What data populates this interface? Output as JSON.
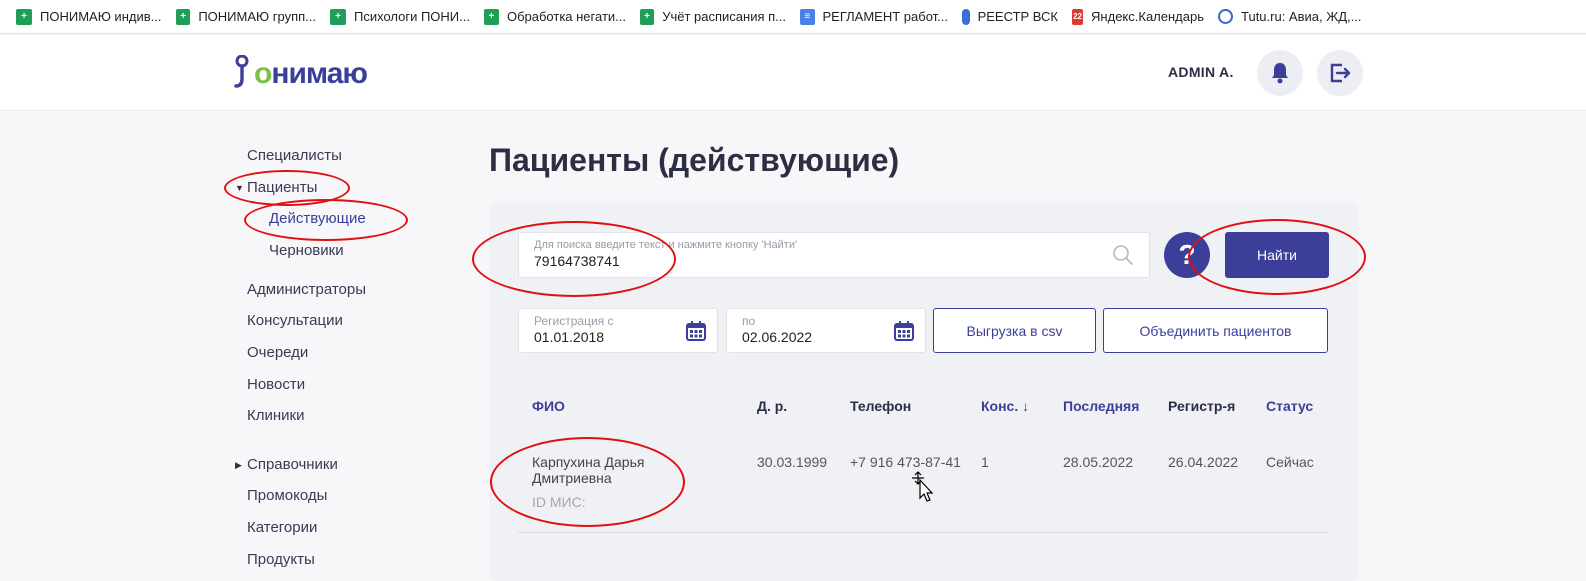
{
  "bookmarks": [
    {
      "label": "ПОНИМАЮ индив...",
      "icon": "sheet-icon"
    },
    {
      "label": "ПОНИМАЮ групп...",
      "icon": "sheet-icon"
    },
    {
      "label": "Психологи ПОНИ...",
      "icon": "sheet-icon"
    },
    {
      "label": "Обработка негати...",
      "icon": "sheet-icon"
    },
    {
      "label": "Учёт расписания п...",
      "icon": "sheet-icon"
    },
    {
      "label": "РЕГЛАМЕНТ работ...",
      "icon": "doc-icon"
    },
    {
      "label": "РЕЕСТР ВСК",
      "icon": "cube-icon"
    },
    {
      "label": "Яндекс.Календарь",
      "icon": "calendar-icon",
      "badge": "22"
    },
    {
      "label": "Tutu.ru: Авиа, ЖД,...",
      "icon": "tutu-icon"
    }
  ],
  "header": {
    "logo_prefix": "",
    "logo_o": "о",
    "logo_suffix": "нимаю",
    "user_name": "ADMIN A."
  },
  "sidebar": {
    "items": [
      {
        "label": "Специалисты"
      },
      {
        "label": "Пациенты",
        "expanded": true
      },
      {
        "label": "Действующие",
        "active": true
      },
      {
        "label": "Черновики"
      },
      {
        "label": "Администраторы"
      },
      {
        "label": "Консультации"
      },
      {
        "label": "Очереди"
      },
      {
        "label": "Новости"
      },
      {
        "label": "Клиники"
      },
      {
        "label": "Справочники",
        "collapsed": true
      },
      {
        "label": "Промокоды"
      },
      {
        "label": "Категории"
      },
      {
        "label": "Продукты"
      }
    ]
  },
  "main": {
    "title": "Пациенты (действующие)",
    "search": {
      "placeholder": "Для поиска введите текст и нажмите кнопку 'Найти'",
      "value": "79164738741"
    },
    "help_label": "?",
    "find_label": "Найти",
    "date_from": {
      "label": "Регистрация с",
      "value": "01.01.2018"
    },
    "date_to": {
      "label": "по",
      "value": "02.06.2022"
    },
    "export_label": "Выгрузка в csv",
    "merge_label": "Объединить пациентов",
    "table": {
      "columns": [
        "ФИО",
        "Д. р.",
        "Телефон",
        "Конс. ↓",
        "Последняя",
        "Регистр-я",
        "Статус"
      ],
      "rows": [
        {
          "name_line1": "Карпухина Дарья",
          "name_line2": "Дмитриевна",
          "mis_id": "ID МИС:",
          "birth": "30.03.1999",
          "phone": "+7 916 473-87-41",
          "consultations": "1",
          "last": "28.05.2022",
          "registered": "26.04.2022",
          "status": "Сейчас"
        }
      ]
    }
  },
  "colors": {
    "accent": "#3b3f9a",
    "logo_green": "#7cc242",
    "annotation": "#e01010"
  }
}
